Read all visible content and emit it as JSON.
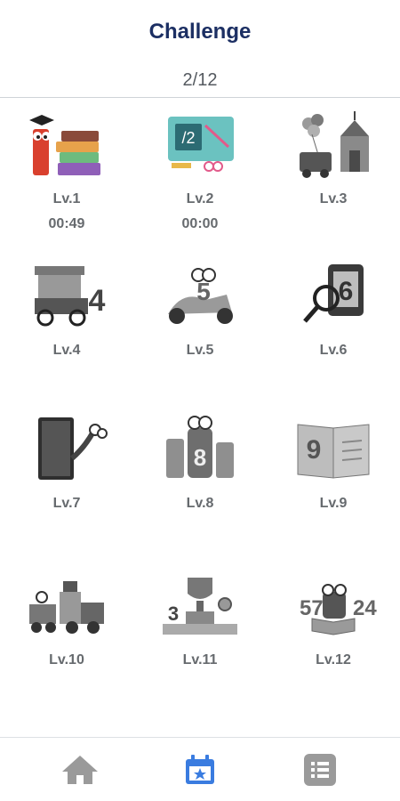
{
  "header": {
    "title": "Challenge",
    "progress": "2/12"
  },
  "levels": [
    {
      "label": "Lv.1",
      "time": "00:49",
      "icon": "books-character-icon",
      "unlocked": true
    },
    {
      "label": "Lv.2",
      "time": "00:00",
      "icon": "chalkboard-fraction-icon",
      "unlocked": true
    },
    {
      "label": "Lv.3",
      "icon": "circus-balloons-icon",
      "unlocked": false
    },
    {
      "label": "Lv.4",
      "icon": "food-cart-icon",
      "unlocked": false
    },
    {
      "label": "Lv.5",
      "icon": "scooter-icon",
      "unlocked": false
    },
    {
      "label": "Lv.6",
      "icon": "magnifier-six-icon",
      "unlocked": false
    },
    {
      "label": "Lv.7",
      "icon": "tree-book-icon",
      "unlocked": false
    },
    {
      "label": "Lv.8",
      "icon": "drinks-character-icon",
      "unlocked": false
    },
    {
      "label": "Lv.9",
      "icon": "open-book-nine-icon",
      "unlocked": false
    },
    {
      "label": "Lv.10",
      "icon": "train-icon",
      "unlocked": false
    },
    {
      "label": "Lv.11",
      "icon": "trophy-podium-icon",
      "unlocked": false
    },
    {
      "label": "Lv.12",
      "icon": "reading-numbers-icon",
      "unlocked": false
    }
  ],
  "nav": [
    {
      "icon": "home-icon",
      "active": false
    },
    {
      "icon": "calendar-star-icon",
      "active": true
    },
    {
      "icon": "list-icon",
      "active": false
    }
  ],
  "colors": {
    "active": "#3a7ce0",
    "inactive": "#9a9a9a",
    "title": "#1c2f63"
  }
}
